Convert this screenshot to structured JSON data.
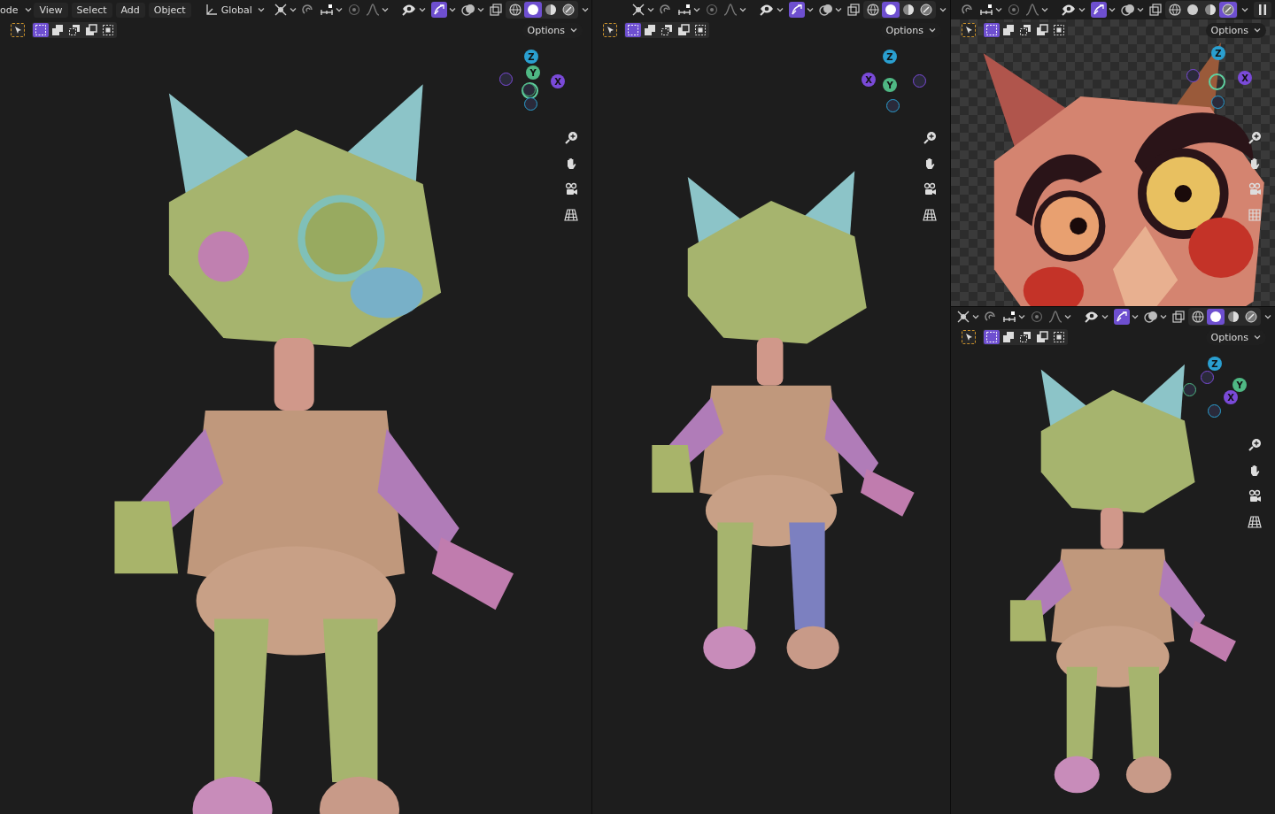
{
  "viewports": [
    {
      "kind": "perspective",
      "menus": [
        "ode",
        "View",
        "Select",
        "Add",
        "Object"
      ],
      "orientation": "Global",
      "options": "Options",
      "show_gizmos": true,
      "shading": [
        {
          "selected": false
        },
        {
          "selected": true
        },
        {
          "selected": false
        },
        {
          "selected": false
        }
      ],
      "select_modes": [
        {
          "selected": true
        },
        {
          "selected": false
        },
        {
          "selected": false
        },
        {
          "selected": false
        },
        {
          "selected": false
        }
      ],
      "transparent_film": false,
      "axes": [
        "Z",
        "Y",
        "X"
      ]
    },
    {
      "kind": "back",
      "options": "Options",
      "show_gizmos": true,
      "shading": [
        {
          "selected": false
        },
        {
          "selected": true
        },
        {
          "selected": false
        },
        {
          "selected": false
        }
      ],
      "select_modes": [
        {
          "selected": true
        },
        {
          "selected": false
        },
        {
          "selected": false
        },
        {
          "selected": false
        },
        {
          "selected": false
        }
      ],
      "transparent_film": false,
      "axes": [
        "Z",
        "X",
        "Y"
      ]
    },
    {
      "kind": "front",
      "options": "Options",
      "show_gizmos": true,
      "shading": [
        {
          "selected": false
        },
        {
          "selected": false
        },
        {
          "selected": false
        },
        {
          "selected": true
        }
      ],
      "select_modes": [
        {
          "selected": true
        },
        {
          "selected": false
        },
        {
          "selected": false
        },
        {
          "selected": false
        },
        {
          "selected": false
        }
      ],
      "transparent_film": true,
      "axes": [
        "Z",
        "X"
      ]
    },
    {
      "kind": "side",
      "options": "Options",
      "show_gizmos": true,
      "shading": [
        {
          "selected": false
        },
        {
          "selected": true
        },
        {
          "selected": false
        },
        {
          "selected": false
        }
      ],
      "select_modes": [
        {
          "selected": true
        },
        {
          "selected": false
        },
        {
          "selected": false
        },
        {
          "selected": false
        },
        {
          "selected": false
        }
      ],
      "transparent_film": false,
      "axes": [
        "Z",
        "Y",
        "X"
      ]
    }
  ]
}
